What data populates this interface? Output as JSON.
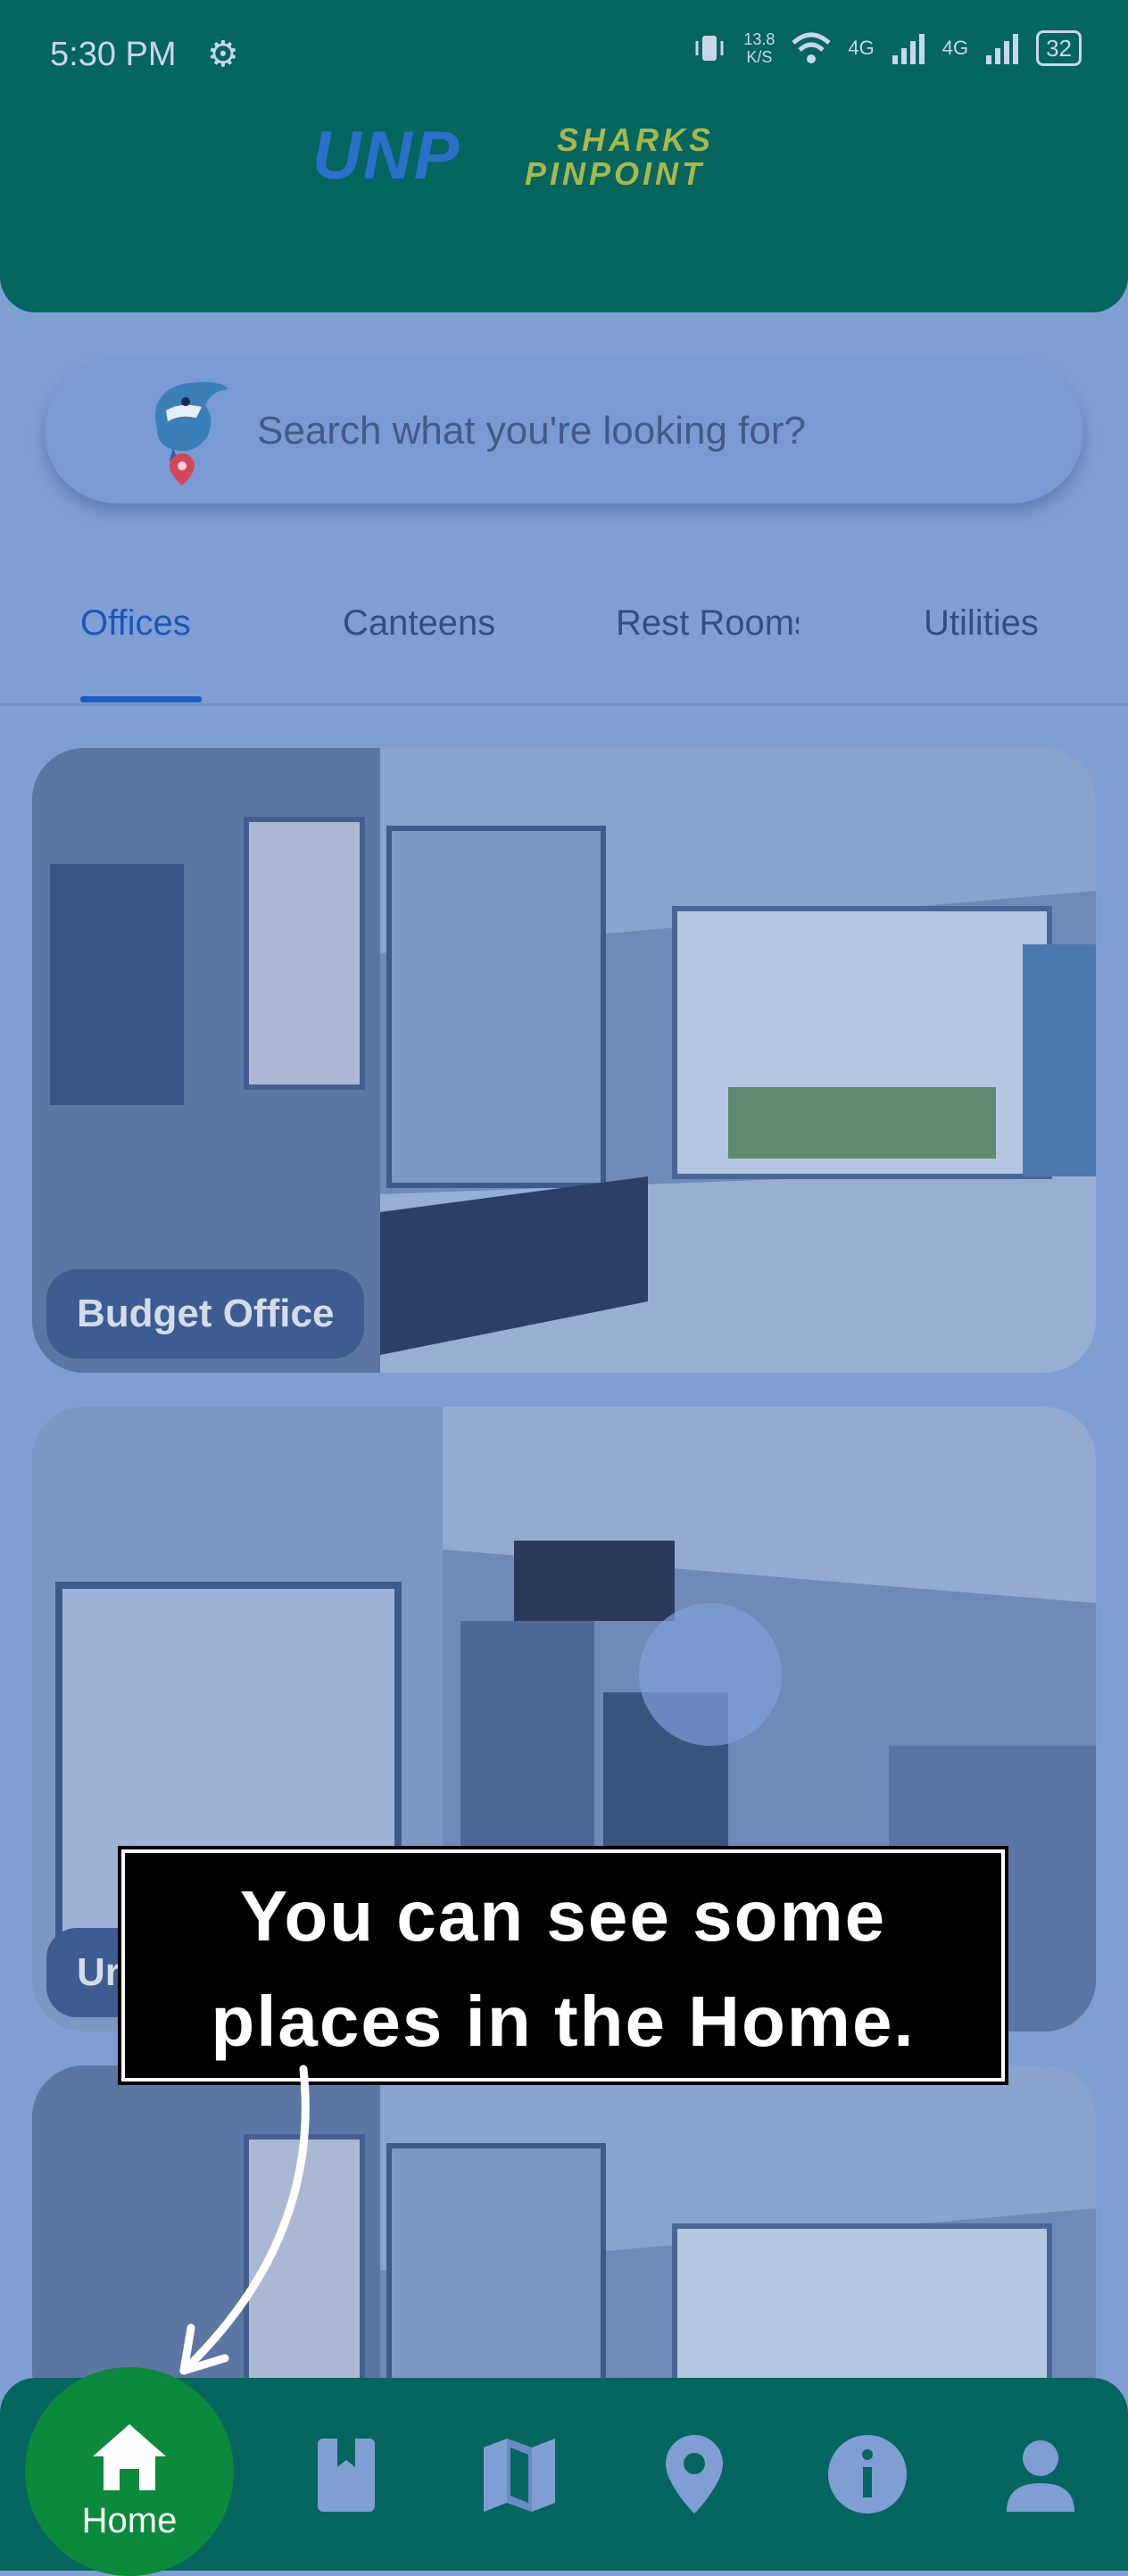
{
  "status_bar": {
    "time": "5:30 PM",
    "net_speed_value": "13.8",
    "net_speed_unit": "K/S",
    "network_1": "4G",
    "network_2": "4G",
    "battery": "32"
  },
  "app": {
    "logo_left": "UNP",
    "logo_right_line1": "SHARKS",
    "logo_right_line2": "PINPOINT"
  },
  "search": {
    "placeholder": "Search what you're looking for?"
  },
  "tabs": [
    {
      "label": "Offices",
      "active": true
    },
    {
      "label": "Canteens",
      "active": false
    },
    {
      "label": "Rest Rooms",
      "active": false
    },
    {
      "label": "Utilities",
      "active": false
    }
  ],
  "cards": [
    {
      "label": "Budget Office"
    },
    {
      "label": "Ur"
    },
    {
      "label": ""
    }
  ],
  "tooltip": {
    "line1": "You can see some",
    "line2": "places in the Home."
  },
  "bottom_nav": {
    "home_label": "Home",
    "items": [
      "home-icon",
      "book-icon",
      "map-icon",
      "location-pin-icon",
      "info-icon",
      "person-icon"
    ]
  },
  "colors": {
    "header": "#05655f",
    "overlay_tint": "#7f9fd4",
    "accent": "#1e5ec2",
    "home_button": "#0a8a3a"
  }
}
